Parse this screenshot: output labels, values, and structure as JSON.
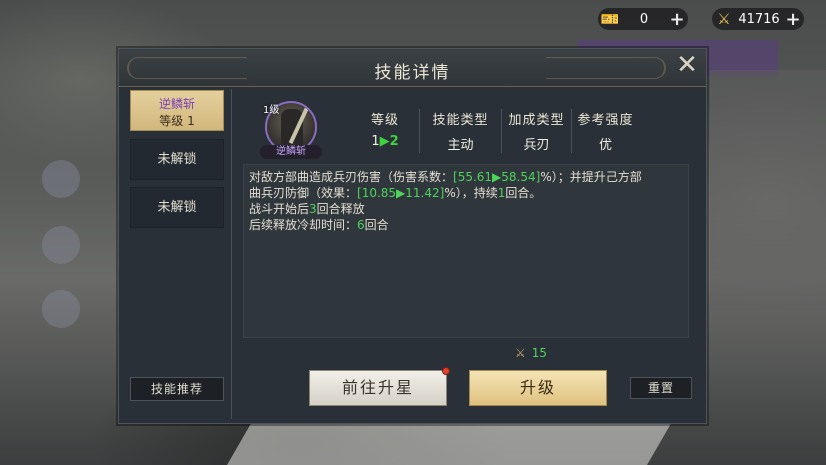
{
  "resources": [
    {
      "icon": "ticket-icon",
      "value": "0"
    },
    {
      "icon": "sword-scroll-icon",
      "value": "41716"
    }
  ],
  "dialog": {
    "title": "技能详情",
    "close_icon": "close-x-icon",
    "skills": [
      {
        "name": "逆鳞斩",
        "level_label": "等级 1",
        "state": "selected"
      },
      {
        "label": "未解锁",
        "state": "locked"
      },
      {
        "label": "未解锁",
        "state": "locked"
      }
    ],
    "recommend_label": "技能推荐",
    "skill_icon": {
      "level": "1级",
      "name": "逆鳞斩",
      "border_color": "#8a6cc4"
    },
    "stats": [
      {
        "header": "等级",
        "from": "1",
        "arrow": "▶",
        "to": "2"
      },
      {
        "header": "技能类型",
        "value": "主动"
      },
      {
        "header": "加成类型",
        "value": "兵刃"
      },
      {
        "header": "参考强度",
        "value": "优"
      }
    ],
    "description": {
      "line1_a": "对敌方部曲造成兵刃伤害（伤害系数：",
      "line1_val": "[55.61▶58.54]",
      "line1_b": "%）；并提升己方部",
      "line2_a": "曲兵刃防御（效果：",
      "line2_val": "[10.85▶11.42]",
      "line2_b": "%），持续",
      "line2_num": "1",
      "line2_c": "回合。",
      "line3_a": "战斗开始后",
      "line3_num": "3",
      "line3_b": "回合释放",
      "line4_a": "后续释放冷却时间：",
      "line4_num": "6",
      "line4_b": "回合"
    },
    "cost": {
      "icon": "sword-scroll-icon",
      "value": "15"
    },
    "buttons": {
      "star_up": "前往升星",
      "upgrade": "升级",
      "reset": "重置"
    }
  },
  "colors": {
    "highlight_green": "#4fd35c",
    "gold_button": "#dfc27f",
    "panel_bg": "#293037",
    "notification_dot": "#e0442e"
  }
}
